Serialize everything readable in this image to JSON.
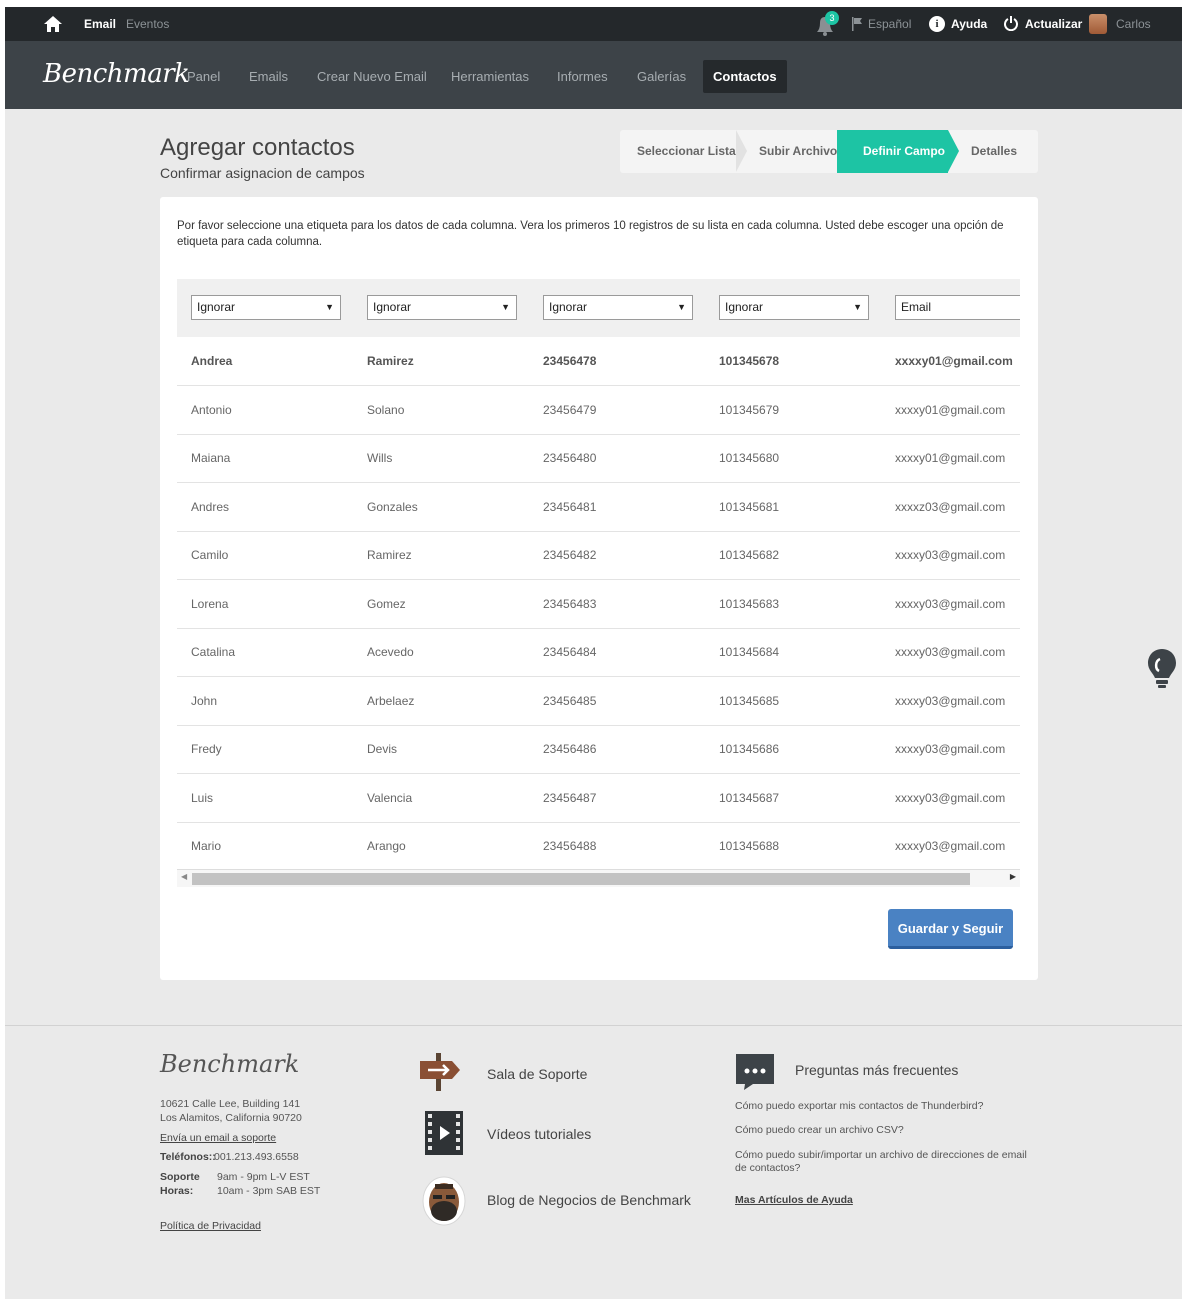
{
  "topbar": {
    "email_label": "Email",
    "eventos_label": "Eventos",
    "notification_count": "3",
    "language_label": "Español",
    "help_label": "Ayuda",
    "update_label": "Actualizar",
    "user_name": "Carlos"
  },
  "brand": {
    "logo_text": "Benchmark"
  },
  "nav": {
    "items": [
      {
        "label": "Panel"
      },
      {
        "label": "Emails"
      },
      {
        "label": "Crear Nuevo Email"
      },
      {
        "label": "Herramientas"
      },
      {
        "label": "Informes"
      },
      {
        "label": "Galerías"
      },
      {
        "label": "Contactos"
      }
    ],
    "active_index": 6
  },
  "page": {
    "title": "Agregar contactos",
    "subtitle": "Confirmar asignacion de campos"
  },
  "steps": [
    {
      "label": "Seleccionar Lista"
    },
    {
      "label": "Subir Archivo"
    },
    {
      "label": "Definir Campo"
    },
    {
      "label": "Detalles"
    }
  ],
  "panel": {
    "instructions": "Por favor seleccione una etiqueta para los datos de cada columna. Vera los primeros 10 registros de su lista en cada columna. Usted debe escoger una opción de etiqueta para cada columna.",
    "column_selects": [
      "Ignorar",
      "Ignorar",
      "Ignorar",
      "Ignorar",
      "Email"
    ],
    "rows": [
      [
        "Andrea",
        "Ramirez",
        "23456478",
        "101345678",
        "xxxxy01@gmail.com"
      ],
      [
        "Antonio",
        "Solano",
        "23456479",
        "101345679",
        "xxxxy01@gmail.com"
      ],
      [
        "Maiana",
        "Wills",
        "23456480",
        "101345680",
        "xxxxy01@gmail.com"
      ],
      [
        "Andres",
        "Gonzales",
        "23456481",
        "101345681",
        "xxxxz03@gmail.com"
      ],
      [
        "Camilo",
        "Ramirez",
        "23456482",
        "101345682",
        "xxxxy03@gmail.com"
      ],
      [
        "Lorena",
        "Gomez",
        "23456483",
        "101345683",
        "xxxxy03@gmail.com"
      ],
      [
        "Catalina",
        "Acevedo",
        "23456484",
        "101345684",
        "xxxxy03@gmail.com"
      ],
      [
        "John",
        "Arbelaez",
        "23456485",
        "101345685",
        "xxxxy03@gmail.com"
      ],
      [
        "Fredy",
        "Devis",
        "23456486",
        "101345686",
        "xxxxy03@gmail.com"
      ],
      [
        "Luis",
        "Valencia",
        "23456487",
        "101345687",
        "xxxxy03@gmail.com"
      ],
      [
        "Mario",
        "Arango",
        "23456488",
        "101345688",
        "xxxxy03@gmail.com"
      ]
    ],
    "save_button": "Guardar y Seguir"
  },
  "footer": {
    "logo_text": "Benchmark",
    "address_line1": "10621 Calle Lee, Building 141",
    "address_line2": "Los Alamitos, California 90720",
    "support_email_link": "Envía un email a soporte",
    "phones_label": "Teléfonos::",
    "phones_value": "001.213.493.6558",
    "support_label": "Soporte",
    "hours_label": "Horas:",
    "support_hours_1": "9am - 9pm L-V EST",
    "support_hours_2": "10am - 3pm SAB EST",
    "privacy_link": "Política de Privacidad",
    "support_room": "Sala de Soporte",
    "video_tutorials": "Vídeos tutoriales",
    "blog": "Blog de Negocios de Benchmark",
    "faq_title": "Preguntas más frecuentes",
    "faq_items": [
      "Cómo puedo exportar mis contactos de Thunderbird?",
      "Cómo puedo crear un archivo CSV?",
      "Cómo puedo subir/importar un archivo de direcciones de email de contactos?"
    ],
    "more_articles": "Mas Artículos de Ayuda"
  }
}
